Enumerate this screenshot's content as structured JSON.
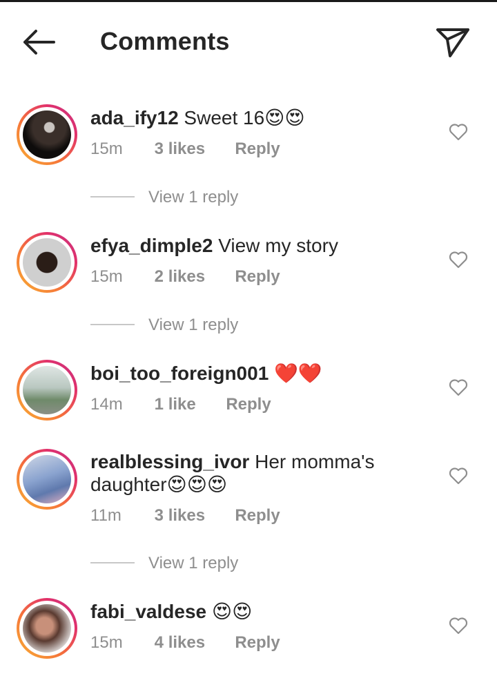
{
  "header": {
    "title": "Comments",
    "back_icon": "arrow-left-icon",
    "send_icon": "paper-plane-icon"
  },
  "colors": {
    "text": "#262626",
    "muted": "#8e8e8e",
    "ring_start": "#f9b233",
    "ring_end": "#c13584",
    "heart_red": "#e0202b"
  },
  "comments": [
    {
      "user": "ada_ify12",
      "text": "Sweet 16",
      "emoji": "😍😍",
      "time": "15m",
      "likes": "3 likes",
      "reply": "Reply",
      "view_replies": "View 1 reply"
    },
    {
      "user": "efya_dimple2",
      "text": "View my story",
      "emoji": "",
      "time": "15m",
      "likes": "2 likes",
      "reply": "Reply",
      "view_replies": "View 1 reply"
    },
    {
      "user": "boi_too_foreign001",
      "text": "",
      "emoji": "❤️❤️",
      "time": "14m",
      "likes": "1 like",
      "reply": "Reply",
      "view_replies": ""
    },
    {
      "user": "realblessing_ivor",
      "text": "Her momma's daughter",
      "emoji": "😍😍😍",
      "time": "11m",
      "likes": "3 likes",
      "reply": "Reply",
      "view_replies": "View 1 reply"
    },
    {
      "user": "fabi_valdese",
      "text": "",
      "emoji": "😍😍",
      "time": "15m",
      "likes": "4 likes",
      "reply": "Reply",
      "view_replies": ""
    }
  ]
}
